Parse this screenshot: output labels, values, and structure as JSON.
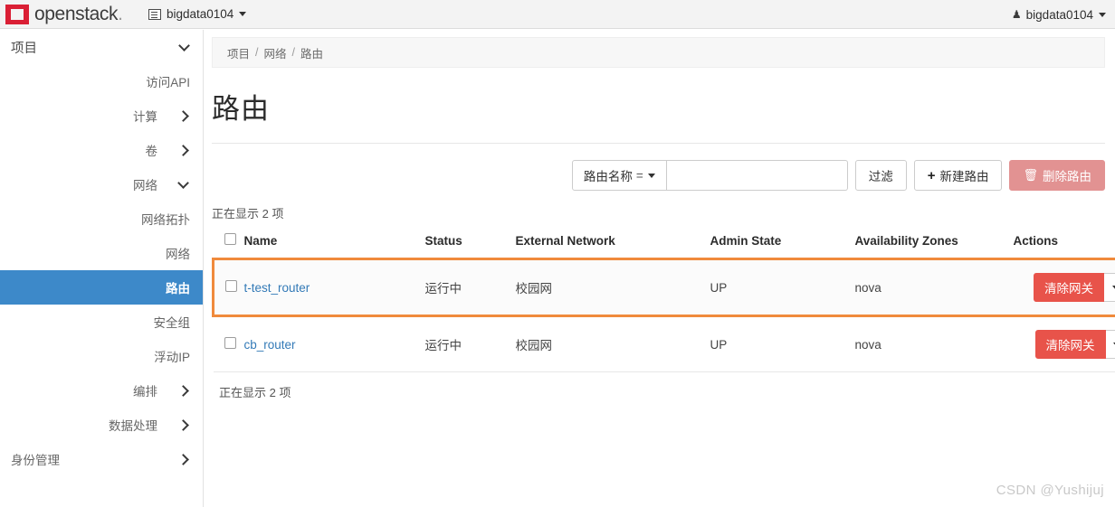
{
  "navbar": {
    "brand_name": "openstack",
    "brand_dot": ".",
    "logo_icon": "openstack-logo-icon",
    "project_switcher": {
      "icon": "project-list-icon",
      "label": "bigdata0104",
      "caret_icon": "caret-down-icon"
    },
    "user_menu": {
      "icon": "user-icon",
      "label": "bigdata0104",
      "caret_icon": "caret-down-icon"
    }
  },
  "sidebar": {
    "group_title": "项目",
    "group_caret_icon": "chevron-down-icon",
    "items": [
      {
        "label": "访问API",
        "type": "link",
        "arrow": "none",
        "active": false
      },
      {
        "label": "计算",
        "type": "group",
        "arrow": "chevron-right-icon",
        "active": false
      },
      {
        "label": "卷",
        "type": "group",
        "arrow": "chevron-right-icon",
        "active": false
      },
      {
        "label": "网络",
        "type": "group",
        "arrow": "chevron-down-icon",
        "active": false
      },
      {
        "label": "网络拓扑",
        "type": "link",
        "arrow": "none",
        "active": false
      },
      {
        "label": "网络",
        "type": "link",
        "arrow": "none",
        "active": false
      },
      {
        "label": "路由",
        "type": "link",
        "arrow": "none",
        "active": true
      },
      {
        "label": "安全组",
        "type": "link",
        "arrow": "none",
        "active": false
      },
      {
        "label": "浮动IP",
        "type": "link",
        "arrow": "none",
        "active": false
      },
      {
        "label": "编排",
        "type": "group",
        "arrow": "chevron-right-icon",
        "active": false
      },
      {
        "label": "数据处理",
        "type": "group",
        "arrow": "chevron-right-icon",
        "active": false
      },
      {
        "label": "身份管理",
        "type": "group",
        "arrow": "chevron-right-icon",
        "active": false
      }
    ]
  },
  "breadcrumb": {
    "items": [
      "项目",
      "网络",
      "路由"
    ],
    "separator": "/"
  },
  "page": {
    "title": "路由"
  },
  "toolbar": {
    "filter_type_label": "路由名称",
    "filter_type_operator": "=",
    "filter_type_caret_icon": "caret-down-icon",
    "filter_input_value": "",
    "filter_input_placeholder": "",
    "filter_button_label": "过滤",
    "create_button_label": "新建路由",
    "create_button_icon": "plus-icon",
    "delete_button_label": "删除路由",
    "delete_button_icon": "trash-icon"
  },
  "table": {
    "count_top": "正在显示 2 项",
    "count_bottom": "正在显示 2 项",
    "select_all_icon": "checkbox-icon",
    "headers": [
      "Name",
      "Status",
      "External Network",
      "Admin State",
      "Availability Zones",
      "Actions"
    ],
    "rows": [
      {
        "checkbox_icon": "checkbox-icon",
        "name": "t-test_router",
        "status": "运行中",
        "external_network": "校园网",
        "admin_state": "UP",
        "availability_zones": "nova",
        "action_label": "清除网关",
        "action_caret_icon": "caret-down-icon",
        "highlighted": true
      },
      {
        "checkbox_icon": "checkbox-icon",
        "name": "cb_router",
        "status": "运行中",
        "external_network": "校园网",
        "admin_state": "UP",
        "availability_zones": "nova",
        "action_label": "清除网关",
        "action_caret_icon": "caret-down-icon",
        "highlighted": false
      }
    ]
  },
  "watermark": "CSDN @Yushijuj",
  "colors": {
    "brand_red": "#da1f35",
    "sidebar_active_blue": "#3d89c9",
    "highlight_orange": "#f08a3c",
    "action_red": "#e8534a",
    "delete_disabled_red": "#e29292",
    "link_blue": "#337ab7"
  }
}
